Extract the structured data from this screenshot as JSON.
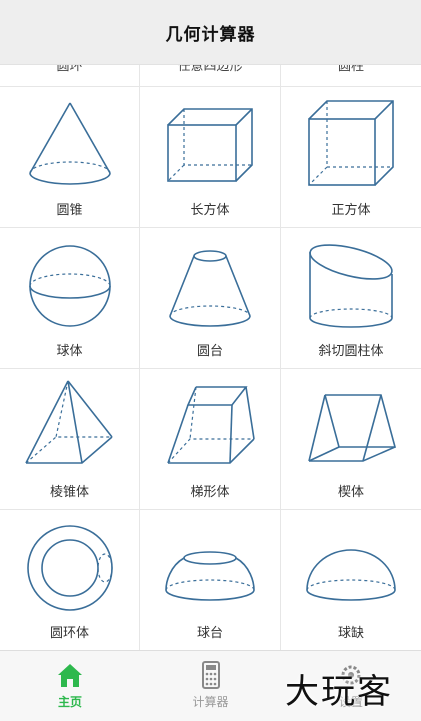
{
  "app": {
    "title": "几何计算器"
  },
  "partial_row": [
    "圆环",
    "任意四边形",
    "圆柱"
  ],
  "shapes": [
    {
      "label": "圆锥",
      "icon": "cone-icon"
    },
    {
      "label": "长方体",
      "icon": "cuboid-icon"
    },
    {
      "label": "正方体",
      "icon": "cube-icon"
    },
    {
      "label": "球体",
      "icon": "sphere-icon"
    },
    {
      "label": "圆台",
      "icon": "frustum-icon"
    },
    {
      "label": "斜切圆柱体",
      "icon": "oblique-cylinder-icon"
    },
    {
      "label": "棱锥体",
      "icon": "pyramid-icon"
    },
    {
      "label": "梯形体",
      "icon": "trapezoid-prism-icon"
    },
    {
      "label": "楔体",
      "icon": "wedge-icon"
    },
    {
      "label": "圆环体",
      "icon": "torus-icon"
    },
    {
      "label": "球台",
      "icon": "spherical-frustum-icon"
    },
    {
      "label": "球缺",
      "icon": "spherical-cap-icon"
    }
  ],
  "tabs": [
    {
      "label": "主页",
      "icon": "home-icon",
      "active": true
    },
    {
      "label": "计算器",
      "icon": "calculator-icon",
      "active": false
    },
    {
      "label": "设置",
      "icon": "settings-icon",
      "active": false
    }
  ],
  "watermark": "大玩客",
  "colors": {
    "stroke": "#3a6e99",
    "active_tab": "#2db84d",
    "header_bg": "#eeeeee"
  }
}
